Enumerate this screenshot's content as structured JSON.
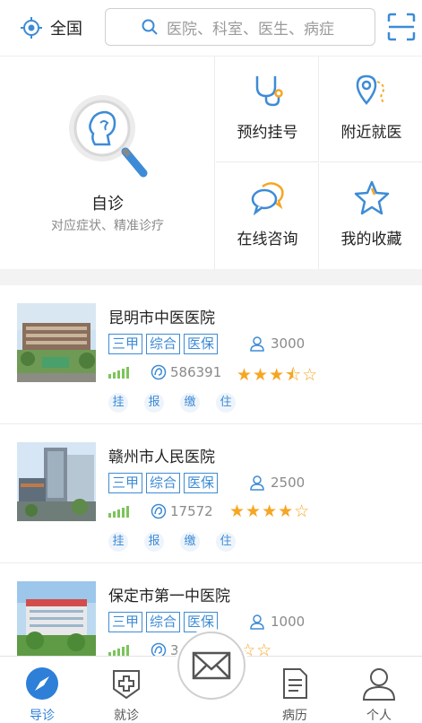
{
  "header": {
    "location": "全国",
    "search_placeholder": "医院、科室、医生、病症"
  },
  "quick": {
    "self_diagnosis": {
      "title": "自诊",
      "subtitle": "对应症状、精准诊疗"
    },
    "tiles": [
      {
        "label": "预约挂号",
        "icon": "stethoscope-icon"
      },
      {
        "label": "附近就医",
        "icon": "location-pin-icon"
      },
      {
        "label": "在线咨询",
        "icon": "chat-bubbles-icon"
      },
      {
        "label": "我的收藏",
        "icon": "star-icon"
      }
    ]
  },
  "hospitals": [
    {
      "name": "昆明市中医医院",
      "tags": [
        "三甲",
        "综合",
        "医保"
      ],
      "followers": "3000",
      "visits": "586391",
      "rating": 3.5,
      "stars": "★★★⯪☆",
      "services": [
        "挂",
        "报",
        "缴",
        "住"
      ]
    },
    {
      "name": "赣州市人民医院",
      "tags": [
        "三甲",
        "综合",
        "医保"
      ],
      "followers": "2500",
      "visits": "17572",
      "rating": 4,
      "stars": "★★★★☆",
      "services": [
        "挂",
        "报",
        "缴",
        "住"
      ]
    },
    {
      "name": "保定市第一中医院",
      "tags": [
        "三甲",
        "综合",
        "医保"
      ],
      "followers": "1000",
      "visits": "3",
      "rating": 1,
      "stars": "★☆☆☆☆",
      "services": []
    }
  ],
  "nav": [
    {
      "label": "导诊",
      "icon": "compass-icon",
      "active": true
    },
    {
      "label": "就诊",
      "icon": "medical-cross-icon",
      "active": false
    },
    {
      "label": "",
      "icon": "mail-icon",
      "active": false
    },
    {
      "label": "病历",
      "icon": "document-icon",
      "active": false
    },
    {
      "label": "个人",
      "icon": "person-icon",
      "active": false
    }
  ],
  "colors": {
    "accent": "#3d8bd6",
    "star": "#f6a623",
    "signal": "#7cc45a",
    "active_nav": "#2d7fd8"
  }
}
